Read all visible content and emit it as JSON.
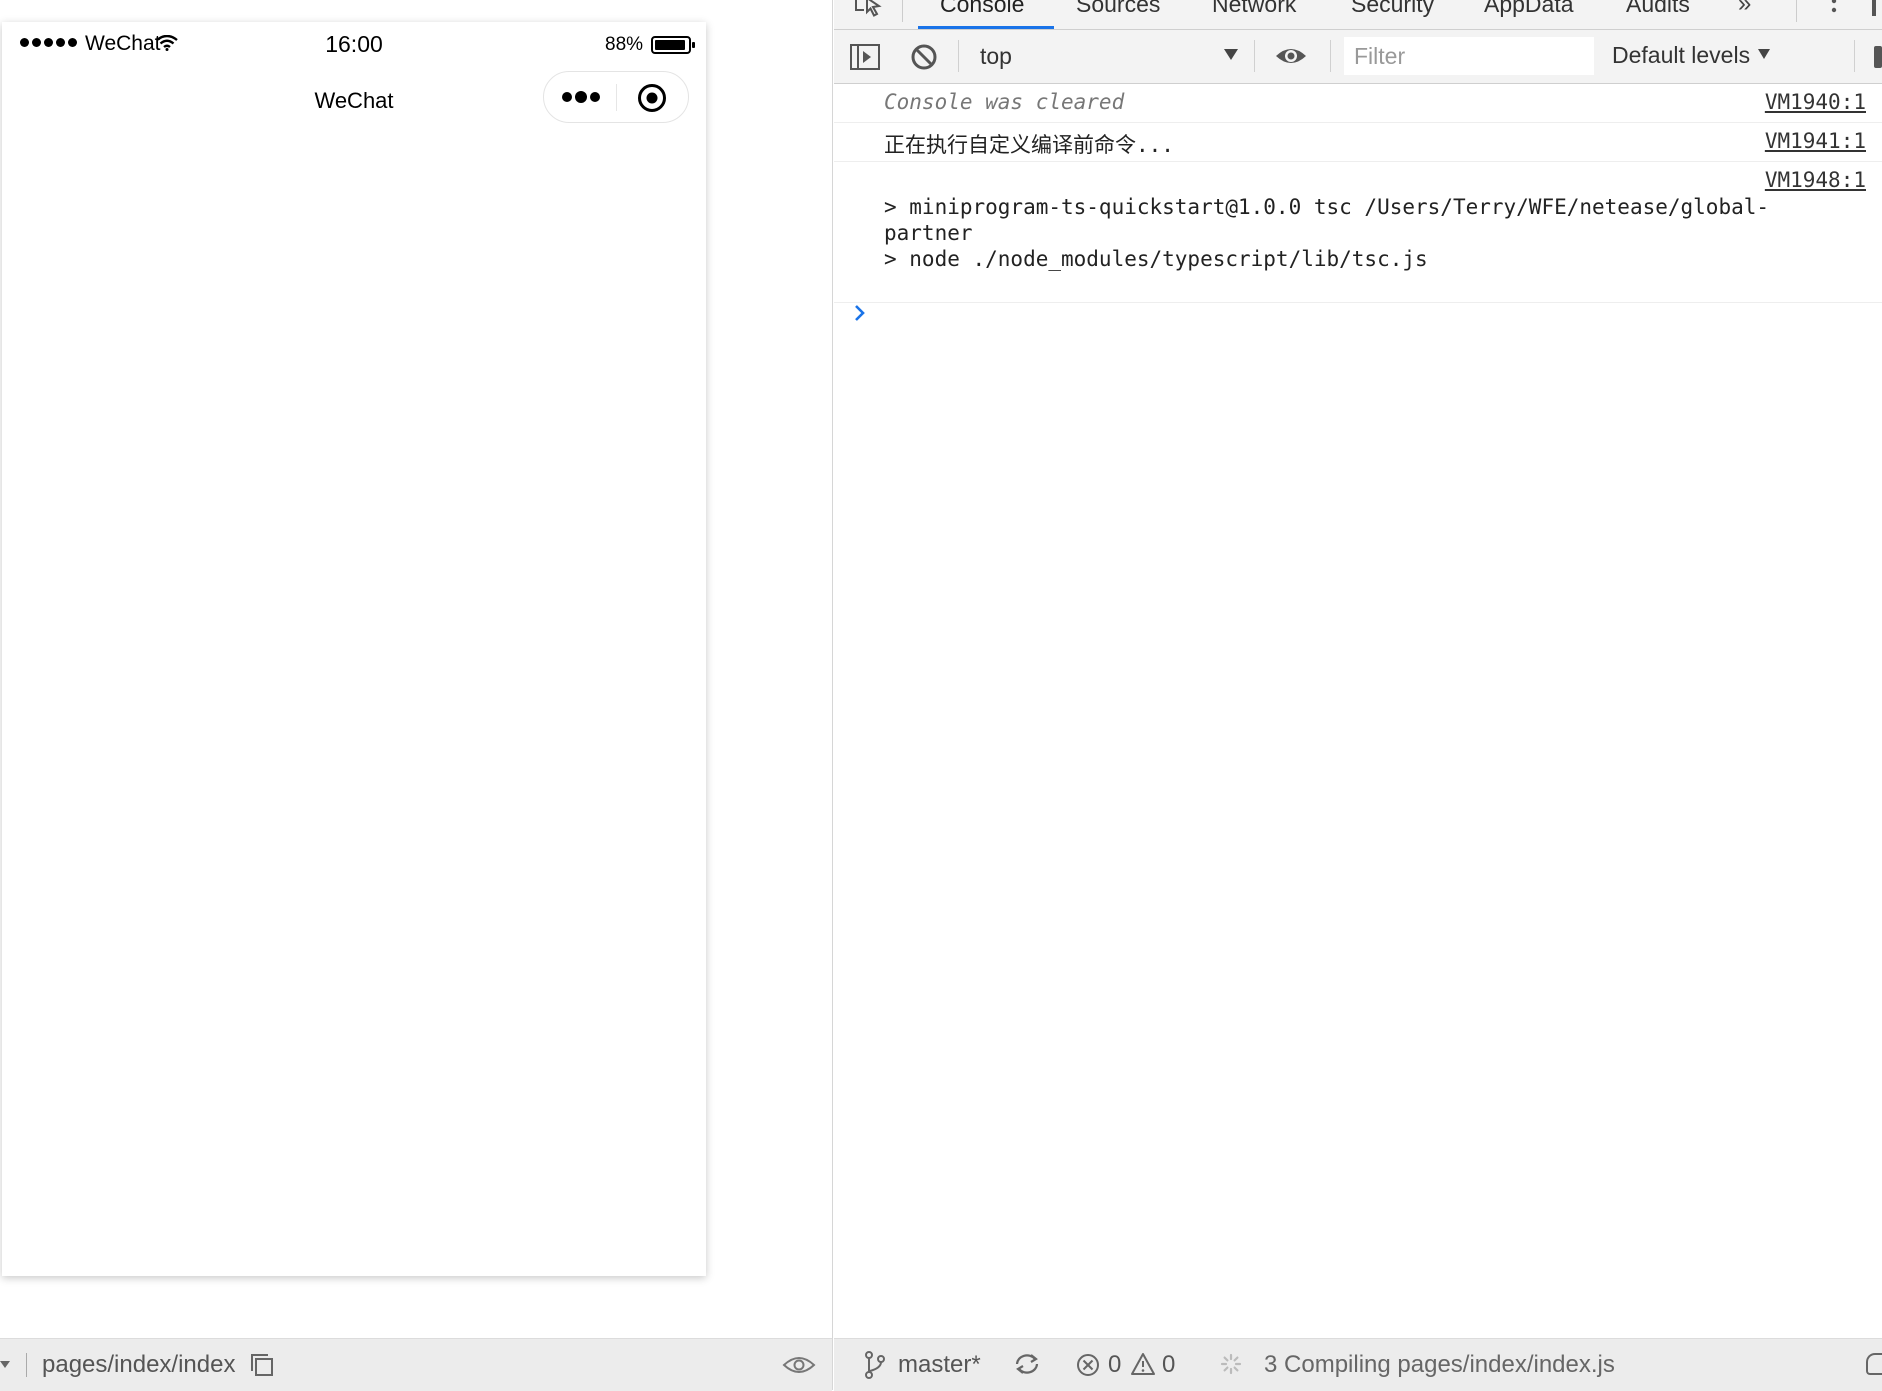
{
  "simulator": {
    "statusbar": {
      "carrier": "WeChat",
      "time": "16:00",
      "battery_percent": "88%"
    },
    "navbar": {
      "title": "WeChat"
    },
    "footer": {
      "page_path": "pages/index/index"
    }
  },
  "devtools": {
    "tabs": [
      "Console",
      "Sources",
      "Network",
      "Security",
      "AppData",
      "Audits"
    ],
    "active_tab": "Console",
    "toolbar": {
      "context": "top",
      "filter_placeholder": "Filter",
      "levels": "Default levels"
    },
    "console": {
      "messages": [
        {
          "text": "Console was cleared",
          "source": "VM1940:1"
        },
        {
          "text": "正在执行自定义编译前命令...",
          "source": "VM1941:1"
        },
        {
          "text": "> miniprogram-ts-quickstart@1.0.0 tsc /Users/Terry/WFE/netease/global-\npartner\n> node ./node_modules/typescript/lib/tsc.js",
          "source": "VM1948:1"
        }
      ]
    },
    "statusbar": {
      "branch": "master*",
      "errors": "0",
      "warnings": "0",
      "compile_status": "3 Compiling pages/index/index.js"
    }
  },
  "icons": {
    "wifi": "wifi-icon",
    "battery": "battery-icon",
    "more": "more-icon",
    "capsule_close": "close-capsule-icon",
    "inspect": "inspect-icon",
    "clear": "clear-icon",
    "eye": "eye-icon",
    "branch": "branch-icon",
    "sync": "sync-icon"
  },
  "colors": {
    "accent": "#1a73e8",
    "prompt": "#1a73e8"
  }
}
